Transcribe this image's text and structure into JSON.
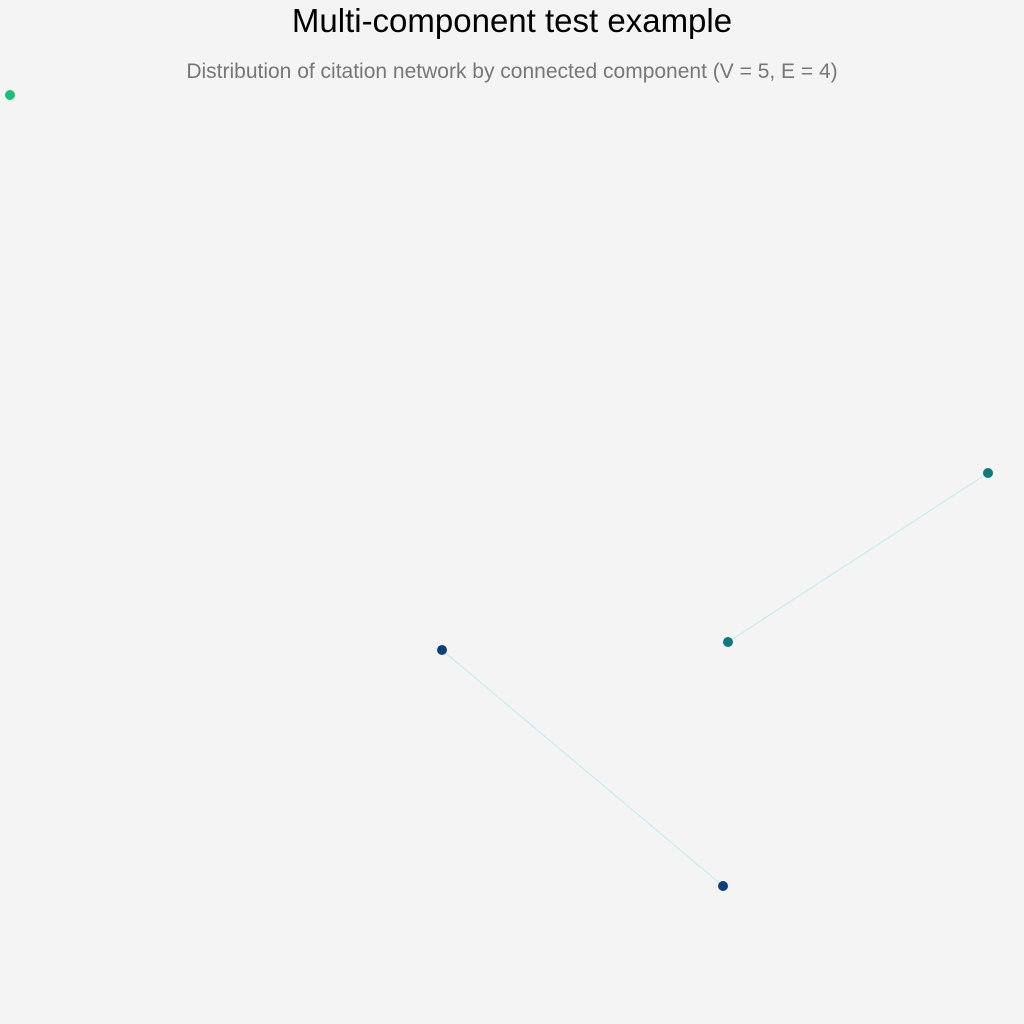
{
  "title": "Multi-component test example",
  "subtitle": "Distribution of citation network by connected component (V = 5, E = 4)",
  "colors": {
    "background": "#f4f4f4",
    "edge": "#c9ecf0",
    "component_green": "#1bbf7a",
    "component_teal": "#0e7a7a",
    "component_navy": "#0d3f7a"
  }
}
